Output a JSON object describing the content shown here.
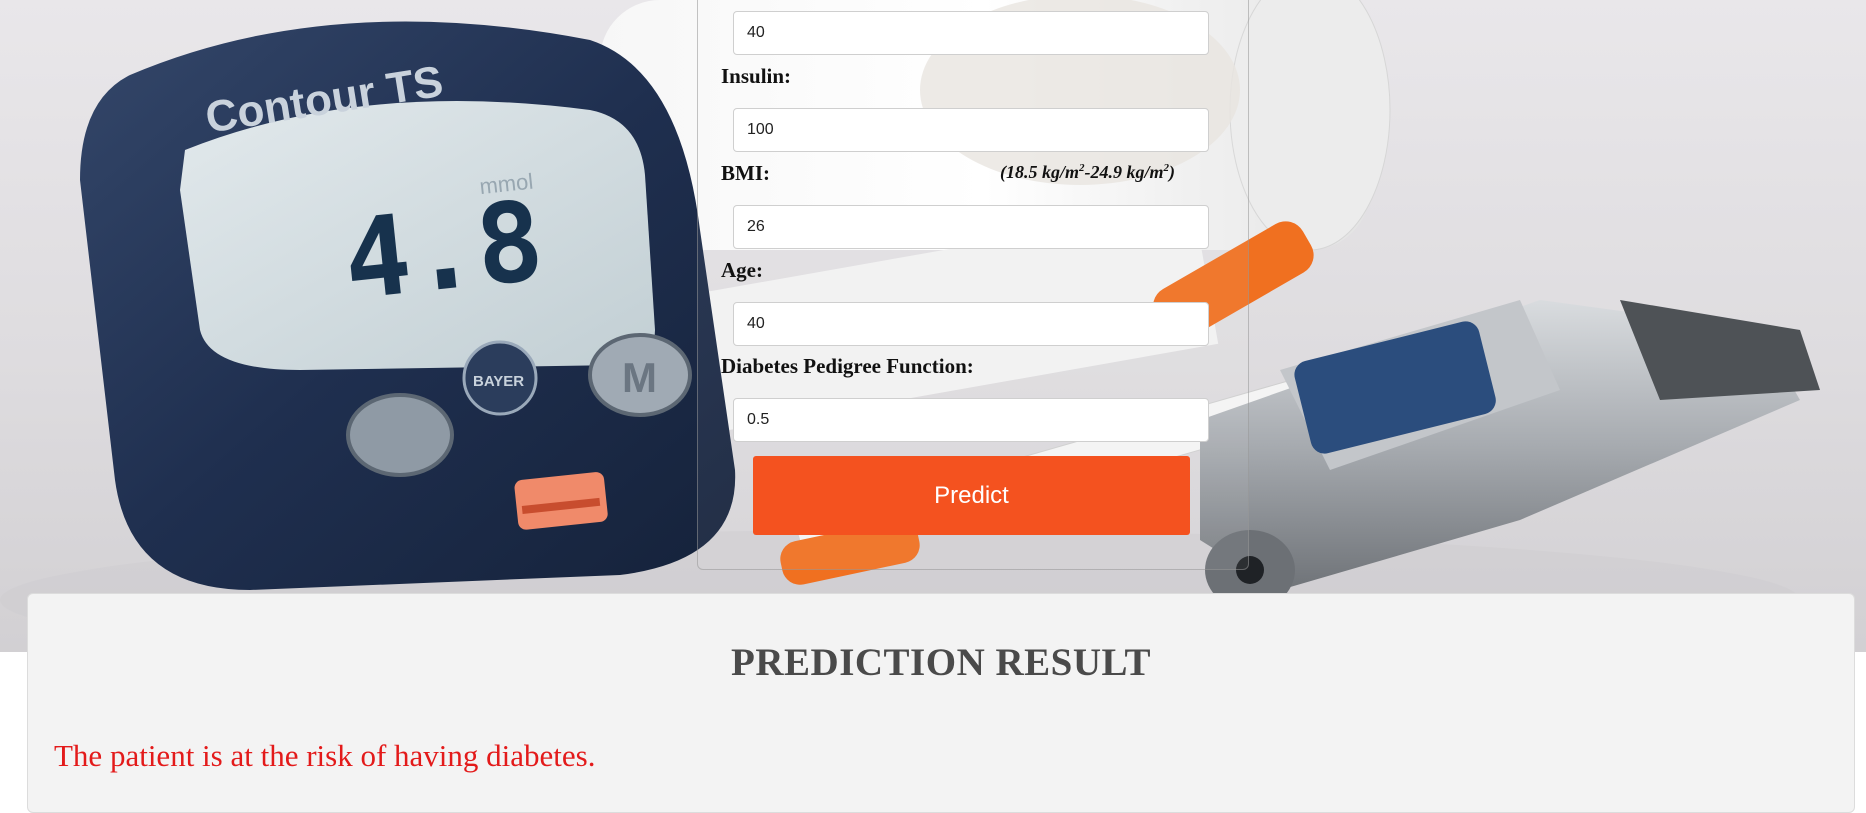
{
  "form": {
    "fields": [
      {
        "label": "",
        "value": "40"
      },
      {
        "label": "Insulin:",
        "value": "100"
      },
      {
        "label": "BMI:",
        "value": "26"
      },
      {
        "label": "Age:",
        "value": "40"
      },
      {
        "label": "Diabetes Pedigree Function:",
        "value": "0.5"
      }
    ],
    "bmi_hint": {
      "open": "(18.5 kg/m",
      "sup1": "2",
      "mid": "-24.9 kg/m",
      "sup2": "2",
      "close": ")"
    },
    "predict_label": "Predict"
  },
  "background": {
    "meter_brand": "Contour TS",
    "meter_reading": "4.8",
    "meter_unit": "mmol",
    "meter_logo": "BAYER",
    "meter_button": "M"
  },
  "result": {
    "title": "PREDICTION RESULT",
    "message": "The patient is at the risk of having diabetes."
  },
  "colors": {
    "accent": "#f4521f",
    "result_text": "#e31a1a",
    "title_text": "#4a4a4a"
  }
}
